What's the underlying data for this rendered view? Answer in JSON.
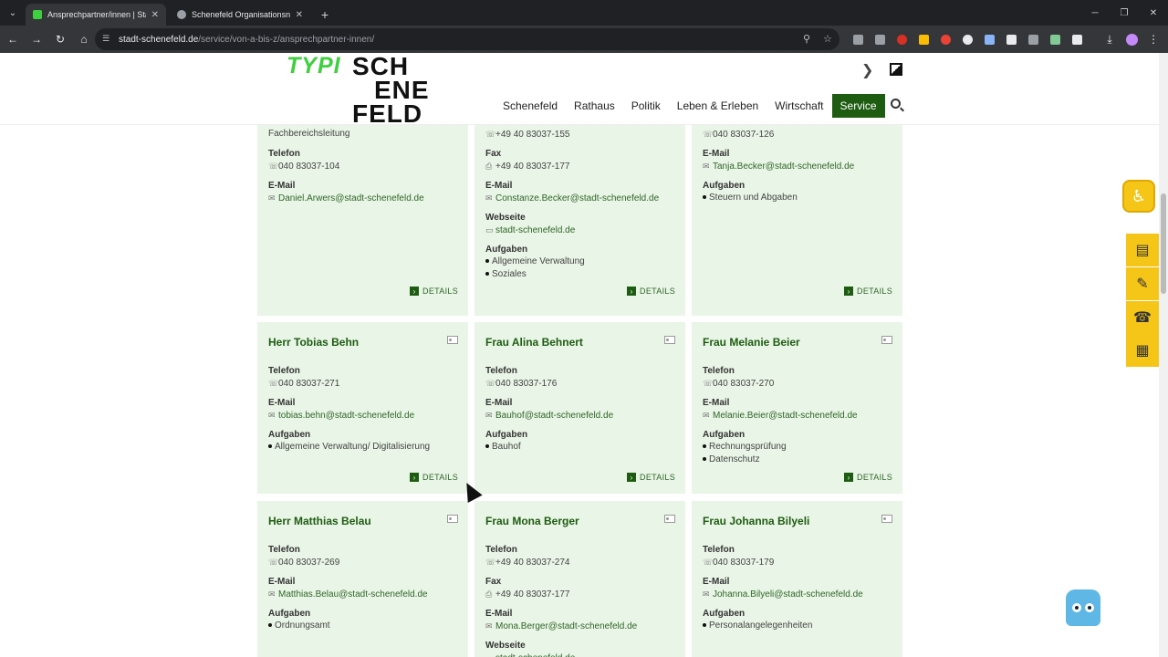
{
  "browser": {
    "tabs": [
      {
        "title": "Ansprechpartner/innen | Stadt",
        "active": true,
        "favicon_color": "#3fcf3f"
      },
      {
        "title": "Schenefeld Organisationsnetz",
        "active": false,
        "favicon_color": "#9aa0a6"
      }
    ],
    "url_host": "stadt-schenefeld.de",
    "url_path": "/service/von-a-bis-z/ansprechpartner-innen/"
  },
  "site": {
    "logo_typi": "TYPI",
    "logo_lines": [
      "SCH",
      "ENE",
      "FELD"
    ],
    "nav": [
      "Schenefeld",
      "Rathaus",
      "Politik",
      "Leben & Erleben",
      "Wirtschaft",
      "Service"
    ],
    "active_nav": "Service"
  },
  "cards_row1": [
    {
      "col": 0,
      "lines": [
        {
          "type": "val",
          "text": "Fachbereichsleitung"
        },
        {
          "type": "lbl",
          "text": "Telefon"
        },
        {
          "type": "val",
          "icon": "phone",
          "text": "040 83037-104"
        },
        {
          "type": "lbl",
          "text": "E-Mail"
        },
        {
          "type": "val",
          "icon": "mail",
          "link": true,
          "text": "Daniel.Arwers@stadt-schenefeld.de"
        }
      ],
      "details": "DETAILS"
    },
    {
      "col": 1,
      "lines": [
        {
          "type": "val",
          "icon": "phone",
          "text": "+49 40 83037-155"
        },
        {
          "type": "lbl",
          "text": "Fax"
        },
        {
          "type": "val",
          "icon": "fax",
          "text": "+49 40 83037-177"
        },
        {
          "type": "lbl",
          "text": "E-Mail"
        },
        {
          "type": "val",
          "icon": "mail",
          "link": true,
          "text": "Constanze.Becker@stadt-schenefeld.de"
        },
        {
          "type": "lbl",
          "text": "Webseite"
        },
        {
          "type": "val",
          "icon": "web",
          "link": true,
          "text": "stadt-schenefeld.de"
        },
        {
          "type": "lbl",
          "text": "Aufgaben"
        },
        {
          "type": "bullet",
          "text": "Allgemeine Verwaltung"
        },
        {
          "type": "bullet",
          "text": "Soziales"
        }
      ],
      "details": "DETAILS"
    },
    {
      "col": 2,
      "lines": [
        {
          "type": "val",
          "icon": "phone",
          "text": "040 83037-126"
        },
        {
          "type": "lbl",
          "text": "E-Mail"
        },
        {
          "type": "val",
          "icon": "mail",
          "link": true,
          "text": "Tanja.Becker@stadt-schenefeld.de"
        },
        {
          "type": "lbl",
          "text": "Aufgaben"
        },
        {
          "type": "bullet",
          "text": "Steuern und Abgaben"
        }
      ],
      "details": "DETAILS"
    }
  ],
  "cards_row2": [
    {
      "name": "Herr Tobias Behn",
      "lines": [
        {
          "type": "lbl",
          "text": "Telefon"
        },
        {
          "type": "val",
          "icon": "phone",
          "text": "040 83037-271"
        },
        {
          "type": "lbl",
          "text": "E-Mail"
        },
        {
          "type": "val",
          "icon": "mail",
          "link": true,
          "text": "tobias.behn@stadt-schenefeld.de"
        },
        {
          "type": "lbl",
          "text": "Aufgaben"
        },
        {
          "type": "bullet",
          "text": "Allgemeine Verwaltung/ Digitalisierung"
        }
      ],
      "details": "DETAILS"
    },
    {
      "name": "Frau Alina Behnert",
      "lines": [
        {
          "type": "lbl",
          "text": "Telefon"
        },
        {
          "type": "val",
          "icon": "phone",
          "text": "040 83037-176"
        },
        {
          "type": "lbl",
          "text": "E-Mail"
        },
        {
          "type": "val",
          "icon": "mail",
          "link": true,
          "text": "Bauhof@stadt-schenefeld.de"
        },
        {
          "type": "lbl",
          "text": "Aufgaben"
        },
        {
          "type": "bullet",
          "text": "Bauhof"
        }
      ],
      "details": "DETAILS"
    },
    {
      "name": "Frau Melanie Beier",
      "lines": [
        {
          "type": "lbl",
          "text": "Telefon"
        },
        {
          "type": "val",
          "icon": "phone",
          "text": "040 83037-270"
        },
        {
          "type": "lbl",
          "text": "E-Mail"
        },
        {
          "type": "val",
          "icon": "mail",
          "link": true,
          "text": "Melanie.Beier@stadt-schenefeld.de"
        },
        {
          "type": "lbl",
          "text": "Aufgaben"
        },
        {
          "type": "bullet",
          "text": "Rechnungsprüfung"
        },
        {
          "type": "bullet",
          "text": "Datenschutz"
        }
      ],
      "details": "DETAILS"
    }
  ],
  "cards_row3": [
    {
      "name": "Herr Matthias Belau",
      "lines": [
        {
          "type": "lbl",
          "text": "Telefon"
        },
        {
          "type": "val",
          "icon": "phone",
          "text": "040 83037-269"
        },
        {
          "type": "lbl",
          "text": "E-Mail"
        },
        {
          "type": "val",
          "icon": "mail",
          "link": true,
          "text": "Matthias.Belau@stadt-schenefeld.de"
        },
        {
          "type": "lbl",
          "text": "Aufgaben"
        },
        {
          "type": "bullet",
          "text": "Ordnungsamt"
        }
      ]
    },
    {
      "name": "Frau Mona Berger",
      "lines": [
        {
          "type": "lbl",
          "text": "Telefon"
        },
        {
          "type": "val",
          "icon": "phone",
          "text": "+49 40 83037-274"
        },
        {
          "type": "lbl",
          "text": "Fax"
        },
        {
          "type": "val",
          "icon": "fax",
          "text": "+49 40 83037-177"
        },
        {
          "type": "lbl",
          "text": "E-Mail"
        },
        {
          "type": "val",
          "icon": "mail",
          "link": true,
          "text": "Mona.Berger@stadt-schenefeld.de"
        },
        {
          "type": "lbl",
          "text": "Webseite"
        },
        {
          "type": "val",
          "icon": "web",
          "link": true,
          "text": "stadt-schenefeld.de"
        }
      ]
    },
    {
      "name": "Frau Johanna Bilyeli",
      "lines": [
        {
          "type": "lbl",
          "text": "Telefon"
        },
        {
          "type": "val",
          "icon": "phone",
          "text": "040 83037-179"
        },
        {
          "type": "lbl",
          "text": "E-Mail"
        },
        {
          "type": "val",
          "icon": "mail",
          "link": true,
          "text": "Johanna.Bilyeli@stadt-schenefeld.de"
        },
        {
          "type": "lbl",
          "text": "Aufgaben"
        },
        {
          "type": "bullet",
          "text": "Personalangelegenheiten"
        }
      ]
    }
  ],
  "side_tools": [
    "document-icon",
    "pencil-icon",
    "phone-icon",
    "calendar-icon"
  ]
}
